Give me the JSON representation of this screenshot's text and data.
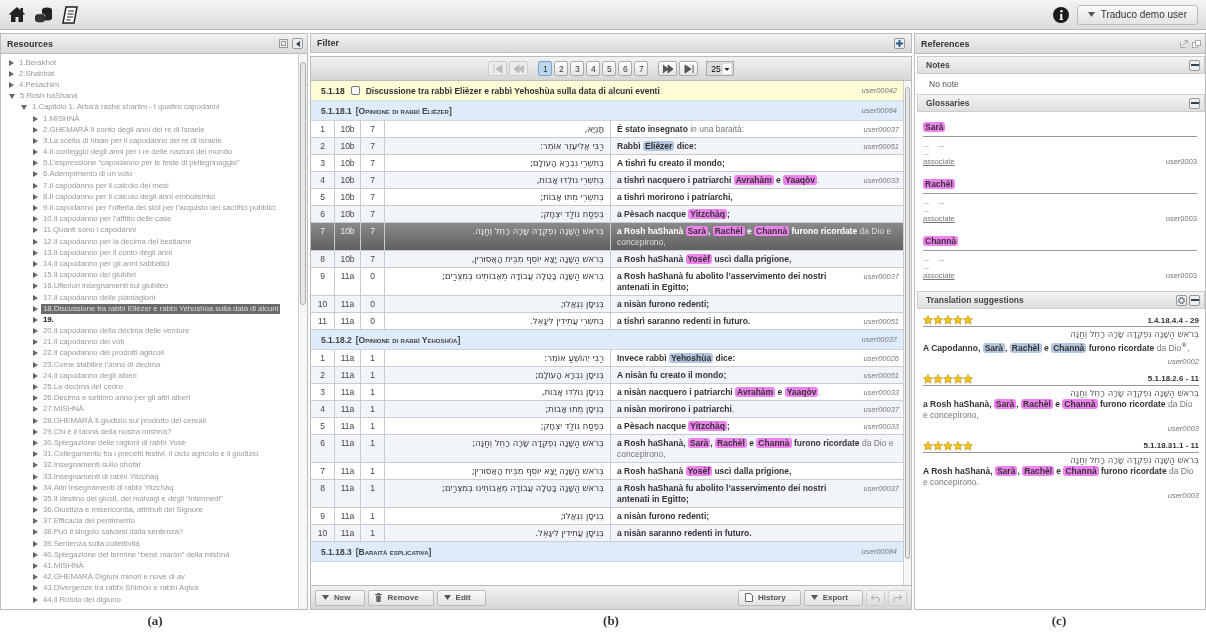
{
  "topbar": {
    "user_menu": "Traduco demo user"
  },
  "resources": {
    "title": "Resources",
    "tree": [
      {
        "label": "1.Berakhòt",
        "expanded": false,
        "selected": false,
        "bold": false
      },
      {
        "label": "2.Shabbàt",
        "expanded": false,
        "selected": false,
        "bold": false
      },
      {
        "label": "4.Pesachim",
        "expanded": false,
        "selected": false,
        "bold": false
      },
      {
        "label": "5.Rosh haShanà",
        "expanded": true,
        "selected": false,
        "bold": false,
        "children": [
          {
            "label": "1.Capitolo 1. Arba’à rashè shanim - I quattro capodanni",
            "expanded": true,
            "selected": false,
            "bold": false,
            "children": [
              {
                "label": "1.MISHNÀ",
                "expanded": false,
                "selected": false,
                "bold": false
              },
              {
                "label": "2.GHEMARÀ Il conto degli anni dei re di Israele",
                "expanded": false,
                "selected": false,
                "bold": false
              },
              {
                "label": "3.La scelta di nisàn per il capodanno dei re di Israele",
                "expanded": false,
                "selected": false,
                "bold": false
              },
              {
                "label": "4.Il conteggio degli anni per i re delle nazioni del mondo",
                "expanded": false,
                "selected": false,
                "bold": false
              },
              {
                "label": "5.L’espressione “capodanno per le feste di pellegrinaggio”",
                "expanded": false,
                "selected": false,
                "bold": false
              },
              {
                "label": "6.Adempimento di un voto",
                "expanded": false,
                "selected": false,
                "bold": false
              },
              {
                "label": "7.Il capodanno per il calcolo dei mesi",
                "expanded": false,
                "selected": false,
                "bold": false
              },
              {
                "label": "8.Il capodanno per il calcolo degli anni embolismici",
                "expanded": false,
                "selected": false,
                "bold": false
              },
              {
                "label": "9.Il capodanno per l’offerta dei sicli per l’acquisto dei sacrifici pubblici",
                "expanded": false,
                "selected": false,
                "bold": false
              },
              {
                "label": "10.Il capodanno per l’affitto delle case",
                "expanded": false,
                "selected": false,
                "bold": false
              },
              {
                "label": "11.Quanti sono i capodanni",
                "expanded": false,
                "selected": false,
                "bold": false
              },
              {
                "label": "12.Il capodanno per la decima del bestiame",
                "expanded": false,
                "selected": false,
                "bold": false
              },
              {
                "label": "13.Il capodanno per il conto degli anni",
                "expanded": false,
                "selected": false,
                "bold": false
              },
              {
                "label": "14.Il capodanno per gli anni sabbatici",
                "expanded": false,
                "selected": false,
                "bold": false
              },
              {
                "label": "15.Il capodanno dei giubilei",
                "expanded": false,
                "selected": false,
                "bold": false
              },
              {
                "label": "16.Ulteriori insegnamenti sul giubileo",
                "expanded": false,
                "selected": false,
                "bold": false
              },
              {
                "label": "17.Il capodanno delle piantagioni",
                "expanded": false,
                "selected": false,
                "bold": false
              },
              {
                "label": "18.Discussione tra rabbì Elièzer e rabbì Yehoshùa sulla data di alcuni",
                "expanded": false,
                "selected": true,
                "bold": false
              },
              {
                "label": "19.",
                "expanded": false,
                "selected": false,
                "bold": true
              },
              {
                "label": "20.Il capodanno della decima delle verdure",
                "expanded": false,
                "selected": false,
                "bold": false
              },
              {
                "label": "21.Il capodanno dei voti",
                "expanded": false,
                "selected": false,
                "bold": false
              },
              {
                "label": "22.Il capodanno dei prodotti agricoli",
                "expanded": false,
                "selected": false,
                "bold": false
              },
              {
                "label": "23.Come stabilire l’anno di decima",
                "expanded": false,
                "selected": false,
                "bold": false
              },
              {
                "label": "24.Il capodanno degli alberi",
                "expanded": false,
                "selected": false,
                "bold": false
              },
              {
                "label": "25.La decima del cedro",
                "expanded": false,
                "selected": false,
                "bold": false
              },
              {
                "label": "26.Decima e settimo anno per gli altri alberi",
                "expanded": false,
                "selected": false,
                "bold": false
              },
              {
                "label": "27.MISHNÀ",
                "expanded": false,
                "selected": false,
                "bold": false
              },
              {
                "label": "28.GHEMARÀ Il giudizio sul prodotto dei cereali",
                "expanded": false,
                "selected": false,
                "bold": false
              },
              {
                "label": "29.Chi è il tannà della nostra mishnà?",
                "expanded": false,
                "selected": false,
                "bold": false
              },
              {
                "label": "30.Spiegazione delle ragioni di rabbì Yosè",
                "expanded": false,
                "selected": false,
                "bold": false
              },
              {
                "label": "31.Collegamento fra i precetti festivi, il ciclo agricolo e il giudizio",
                "expanded": false,
                "selected": false,
                "bold": false
              },
              {
                "label": "32.Insegnamenti sullo shofàr",
                "expanded": false,
                "selected": false,
                "bold": false
              },
              {
                "label": "33.Insegnamenti di rabbì Yitzchàq",
                "expanded": false,
                "selected": false,
                "bold": false
              },
              {
                "label": "34.Altri insegnamenti di rabbì Yitzchàq",
                "expanded": false,
                "selected": false,
                "bold": false
              },
              {
                "label": "35.Il destino dei giusti, dei malvagi e degli “intermedi”",
                "expanded": false,
                "selected": false,
                "bold": false
              },
              {
                "label": "36.Giustizia e misericordia, attributi del Signore",
                "expanded": false,
                "selected": false,
                "bold": false
              },
              {
                "label": "37.Efficacia del pentimento",
                "expanded": false,
                "selected": false,
                "bold": false
              },
              {
                "label": "38.Può il singolo salvarsi dalla sentenza?",
                "expanded": false,
                "selected": false,
                "bold": false
              },
              {
                "label": "39.Sentenza sulla collettività",
                "expanded": false,
                "selected": false,
                "bold": false
              },
              {
                "label": "40.Spiegazione del termine “benè maròn” della mishnà",
                "expanded": false,
                "selected": false,
                "bold": false
              },
              {
                "label": "41.MISHNÀ",
                "expanded": false,
                "selected": false,
                "bold": false
              },
              {
                "label": "42.GHEMARÀ Digiuni minori e nove di av",
                "expanded": false,
                "selected": false,
                "bold": false
              },
              {
                "label": "43.Divergenze tra rabbì Shimòn e rabbì Aqivà",
                "expanded": false,
                "selected": false,
                "bold": false
              },
              {
                "label": "44.Il Rotolo del digiuno",
                "expanded": false,
                "selected": false,
                "bold": false
              }
            ]
          }
        ]
      }
    ]
  },
  "editor": {
    "filter_title": "Filter",
    "pager": {
      "nav_before": [
        {
          "kind": "first",
          "disabled": true
        },
        {
          "kind": "previous",
          "disabled": true
        }
      ],
      "pages": [
        {
          "label": "1",
          "selected": true
        },
        {
          "label": "2",
          "selected": false
        },
        {
          "label": "3",
          "selected": false
        },
        {
          "label": "4",
          "selected": false
        },
        {
          "label": "5",
          "selected": false
        },
        {
          "label": "6",
          "selected": false
        },
        {
          "label": "7",
          "selected": false
        }
      ],
      "nav_after": [
        {
          "kind": "next",
          "disabled": false
        },
        {
          "kind": "last",
          "disabled": false
        }
      ],
      "page_size": "25"
    },
    "segment": {
      "number": "5.1.18",
      "checked": false,
      "title": "Discussione tra rabbì Elièzer e rabbì Yehoshùa sulla data di alcuni eventi",
      "user": "user00042"
    },
    "sections": [
      {
        "number": "5.1.18.1",
        "title": "[Opinione di rabbì Elièzer]",
        "user": "user00084",
        "rows": [
          {
            "n": "1",
            "folio": "10b",
            "line": "7",
            "hebrew": "תָּנְיָא,",
            "selected": false,
            "user": "user00037",
            "segments": [
              {
                "kind": "bold",
                "text": "È stato insegnato"
              },
              {
                "kind": "plain",
                "text": " in una baraità:"
              }
            ]
          },
          {
            "n": "2",
            "folio": "10b",
            "line": "7",
            "hebrew": "רַבִּי אֱלִיעֶזֶר אוֹמֵר:",
            "selected": false,
            "user": "user00051",
            "segments": [
              {
                "kind": "bold",
                "text": "Rabbì "
              },
              {
                "kind": "tag",
                "text": "Elièzer",
                "color": "#b4c6de"
              },
              {
                "kind": "bold",
                "text": " dice:"
              }
            ]
          },
          {
            "n": "3",
            "folio": "10b",
            "line": "7",
            "hebrew": "בְּתִשְׁרֵי נִבְרָא הָעוֹלָם;",
            "selected": false,
            "segments": [
              {
                "kind": "bold",
                "text": "A tishrì fu creato il mondo;"
              }
            ]
          },
          {
            "n": "4",
            "folio": "10b",
            "line": "7",
            "hebrew": "בְּתִשְׁרֵי נוֹלְדוּ אָבוֹת,",
            "selected": false,
            "user": "user00033",
            "segments": [
              {
                "kind": "bold",
                "text": "a tishrì nacquero i patriarchi "
              },
              {
                "kind": "tag",
                "text": "Avrahàm",
                "color": "#ee82ee"
              },
              {
                "kind": "bold",
                "text": " e "
              },
              {
                "kind": "tag",
                "text": "Yaaqòv",
                "color": "#ee82ee"
              },
              {
                "kind": "plain",
                "text": "."
              }
            ]
          },
          {
            "n": "5",
            "folio": "10b",
            "line": "7",
            "hebrew": "בְּתִשְׁרֵי מֵתוּ אָבוֹת;",
            "selected": false,
            "segments": [
              {
                "kind": "bold",
                "text": "a tishrì morirono i patriarchi,"
              }
            ]
          },
          {
            "n": "6",
            "folio": "10b",
            "line": "7",
            "hebrew": "בְּפֶסַח נוֹלַד יִצְחָק;",
            "selected": false,
            "segments": [
              {
                "kind": "bold",
                "text": "a Pèsach nacque "
              },
              {
                "kind": "tag",
                "text": "Yitzchàq",
                "color": "#ee82ee"
              },
              {
                "kind": "bold",
                "text": ";"
              }
            ]
          },
          {
            "n": "7",
            "folio": "10b",
            "line": "7",
            "hebrew": "בְּרֹאשׁ הַשָּׁנָה נִפְקְדָה שָׂרָה רָחֵל וְחַנָּה.",
            "selected": true,
            "segments": [
              {
                "kind": "bold",
                "text": "a Rosh haShanà "
              },
              {
                "kind": "tag",
                "text": "Sarà",
                "color": "#ee82ee"
              },
              {
                "kind": "bold",
                "text": ", "
              },
              {
                "kind": "tag",
                "text": "Rachèl",
                "color": "#ee82ee"
              },
              {
                "kind": "bold",
                "text": " e "
              },
              {
                "kind": "tag",
                "text": "Channà",
                "color": "#ee82ee"
              },
              {
                "kind": "bold",
                "text": " furono ricordate"
              },
              {
                "kind": "plain",
                "text": " da Dio e concepirono,"
              }
            ]
          },
          {
            "n": "8",
            "folio": "10b",
            "line": "7",
            "hebrew": "בְּרֹאשׁ הַשָּׁנָה יָצָא יוֹסֵף מִבֵּית הָאֲסוּרִין,",
            "selected": false,
            "segments": [
              {
                "kind": "bold",
                "text": "a Rosh haShanà "
              },
              {
                "kind": "tag",
                "text": "Yosèf",
                "color": "#ee82ee"
              },
              {
                "kind": "bold",
                "text": " uscì dalla prigione,"
              }
            ]
          },
          {
            "n": "9",
            "folio": "11a",
            "line": "0",
            "hebrew": "בְּרֹאשׁ הַשָּׁנָה בָּטְלָה עֲבוֹדָה מֵאֲבוֹתֵינוּ בְּמִצְרַיִם;",
            "selected": false,
            "user": "user00037",
            "segments": [
              {
                "kind": "bold",
                "text": "a Rosh haShanà fu abolito l’asservimento dei nostri antenati in Egitto;"
              }
            ]
          },
          {
            "n": "10",
            "folio": "11a",
            "line": "0",
            "hebrew": "בְּנִיסָן נִגְאֲלוּ;",
            "selected": false,
            "segments": [
              {
                "kind": "bold",
                "text": "a nisàn furono redenti;"
              }
            ]
          },
          {
            "n": "11",
            "folio": "11a",
            "line": "0",
            "hebrew": "בְּתִשְׁרֵי עֲתִידִין לִיגָּאֵל.",
            "selected": false,
            "user": "user00051",
            "segments": [
              {
                "kind": "bold",
                "text": "a tishrì saranno redenti in futuro."
              }
            ]
          }
        ]
      },
      {
        "number": "5.1.18.2",
        "title": "[Opinione di rabbì Yehoshùa]",
        "user": "user00037",
        "rows": [
          {
            "n": "1",
            "folio": "11a",
            "line": "1",
            "hebrew": "רַבִּי יְהוֹשֻׁעַ אוֹמֵר:",
            "selected": false,
            "user": "user00026",
            "segments": [
              {
                "kind": "bold",
                "text": "Invece rabbì "
              },
              {
                "kind": "tag",
                "text": "Yehoshùa",
                "color": "#b4c6de"
              },
              {
                "kind": "bold",
                "text": " dice:"
              }
            ]
          },
          {
            "n": "2",
            "folio": "11a",
            "line": "1",
            "hebrew": "בְּנִיסָן נִבְרָא הָעוֹלָם;",
            "selected": false,
            "user": "user00051",
            "segments": [
              {
                "kind": "bold",
                "text": "A nisàn fu creato il mondo;"
              }
            ]
          },
          {
            "n": "3",
            "folio": "11a",
            "line": "1",
            "hebrew": "בְּנִיסָן נוֹלְדוּ אָבוֹת,",
            "selected": false,
            "user": "user00033",
            "segments": [
              {
                "kind": "bold",
                "text": "a nisàn nacquero i patriarchi "
              },
              {
                "kind": "tag",
                "text": "Avrahàm",
                "color": "#ee82ee"
              },
              {
                "kind": "bold",
                "text": " e "
              },
              {
                "kind": "tag",
                "text": "Yaaqòv",
                "color": "#ee82ee"
              },
              {
                "kind": "plain",
                "text": "."
              }
            ]
          },
          {
            "n": "4",
            "folio": "11a",
            "line": "1",
            "hebrew": "בְּנִיסָן מֵתוּ אָבוֹת;",
            "selected": false,
            "user": "user00037",
            "segments": [
              {
                "kind": "bold",
                "text": "a nisàn morirono i patriarchi"
              },
              {
                "kind": "plain",
                "text": ","
              }
            ]
          },
          {
            "n": "5",
            "folio": "11a",
            "line": "1",
            "hebrew": "בְּפֶסַח נוֹלַד יִצְחָק;",
            "selected": false,
            "user": "user00033",
            "segments": [
              {
                "kind": "bold",
                "text": "a Pèsach nacque "
              },
              {
                "kind": "tag",
                "text": "Yitzchàq",
                "color": "#ee82ee"
              },
              {
                "kind": "bold",
                "text": ";"
              }
            ]
          },
          {
            "n": "6",
            "folio": "11a",
            "line": "1",
            "hebrew": "בְּרֹאשׁ הַשָּׁנָה נִפְקְדָה שָׂרָה רָחֵל וְחַנָּה;",
            "selected": false,
            "segments": [
              {
                "kind": "bold",
                "text": "a Rosh haShanà, "
              },
              {
                "kind": "tag",
                "text": "Sarà",
                "color": "#ee82ee"
              },
              {
                "kind": "bold",
                "text": ", "
              },
              {
                "kind": "tag",
                "text": "Rachèl",
                "color": "#ee82ee"
              },
              {
                "kind": "bold",
                "text": " e "
              },
              {
                "kind": "tag",
                "text": "Channà",
                "color": "#ee82ee"
              },
              {
                "kind": "bold",
                "text": " furono ricordate"
              },
              {
                "kind": "plain",
                "text": " da Dio e concepirono,"
              }
            ]
          },
          {
            "n": "7",
            "folio": "11a",
            "line": "1",
            "hebrew": "בְּרֹאשׁ הַשָּׁנָה יָצָא יוֹסֵף מִבֵּית הָאֲסוּרִין;",
            "selected": false,
            "segments": [
              {
                "kind": "bold",
                "text": "a Rosh haShanà "
              },
              {
                "kind": "tag",
                "text": "Yosèf",
                "color": "#ee82ee"
              },
              {
                "kind": "bold",
                "text": " uscì dalla prigione,"
              }
            ]
          },
          {
            "n": "8",
            "folio": "11a",
            "line": "1",
            "hebrew": "בְּרֹאשׁ הַשָּׁנָה בָּטְלָה עֲבוֹדָה מֵאֲבוֹתֵינוּ בְּמִצְרַיִם;",
            "selected": false,
            "user": "user00037",
            "segments": [
              {
                "kind": "bold",
                "text": "a Rosh haShanà fu abolito l’asservimento dei nostri antenati in Egitto;"
              }
            ]
          },
          {
            "n": "9",
            "folio": "11a",
            "line": "1",
            "hebrew": "בְּנִיסָן נִגְאֲלוּ;",
            "selected": false,
            "segments": [
              {
                "kind": "bold",
                "text": "a nisàn furono redenti;"
              }
            ]
          },
          {
            "n": "10",
            "folio": "11a",
            "line": "1",
            "hebrew": "בְּנִיסָן עֲתִידִין לִיגָּאֵל.",
            "selected": false,
            "segments": [
              {
                "kind": "bold",
                "text": "a nisàn saranno redenti in futuro."
              }
            ]
          }
        ]
      },
      {
        "number": "5.1.18.3",
        "title": "[Baraità esplicativa]",
        "user": "user00084"
      }
    ],
    "actions_left": [
      {
        "label": "New",
        "kind": "menu"
      },
      {
        "label": "Remove",
        "kind": "trash"
      },
      {
        "label": "Edit",
        "kind": "menu"
      }
    ],
    "actions_right": [
      {
        "label": "History",
        "kind": "history"
      },
      {
        "label": "Export",
        "kind": "menu"
      }
    ],
    "history_nav": [
      {
        "kind": "undo",
        "disabled": true
      },
      {
        "kind": "redo",
        "disabled": true
      }
    ]
  },
  "references": {
    "title": "References",
    "notes": {
      "title": "Notes",
      "empty_text": "No note"
    },
    "glossaries": {
      "title": "Glossaries",
      "entries": [
        {
          "term": "Sarà",
          "color": "#ee82ee",
          "fields": [
            "...",
            "..."
          ],
          "note": "...",
          "link": "associate",
          "user": "user0003"
        },
        {
          "term": "Rachèl",
          "color": "#ee82ee",
          "fields": [
            "...",
            "..."
          ],
          "note": "...",
          "link": "associate",
          "user": "user0003"
        },
        {
          "term": "Channà",
          "color": "#ee82ee",
          "fields": [
            "...",
            "..."
          ],
          "note": "...",
          "link": "associate",
          "user": "user0003"
        }
      ]
    },
    "suggestions": {
      "title": "Translation suggestions",
      "items": [
        {
          "stars": 5,
          "ref": "1.4.18.4.4 - 29",
          "hebrew": "בְּרֹאשׁ הַשָּׁנָה נִפְקְדָה שָׂרָה רָחֵל וְחַנָּה",
          "user": "user0002",
          "segments": [
            {
              "kind": "bold",
              "text": "A Capodanno, "
            },
            {
              "kind": "tag",
              "text": "Sarà",
              "color": "#b4c6de"
            },
            {
              "kind": "bold",
              "text": ", "
            },
            {
              "kind": "tag",
              "text": "Rachèl",
              "color": "#b4c6de"
            },
            {
              "kind": "bold",
              "text": " e "
            },
            {
              "kind": "tag",
              "text": "Channà",
              "color": "#b4c6de"
            },
            {
              "kind": "bold",
              "text": " furono ricordate"
            },
            {
              "kind": "plain",
              "text": " da Dio"
            },
            {
              "kind": "sup",
              "text": "⑧"
            },
            {
              "kind": "plain",
              "text": ","
            }
          ]
        },
        {
          "stars": 5,
          "ref": "5.1.18.2.6 - 11",
          "hebrew": "בְּרֹאשׁ הַשָּׁנָה נִפְקְדָה שָׂרָה רָחֵל וְחַנָּה",
          "user": "user0003",
          "segments": [
            {
              "kind": "bold",
              "text": "a Rosh haShanà, "
            },
            {
              "kind": "tag",
              "text": "Sarà",
              "color": "#ee82ee"
            },
            {
              "kind": "bold",
              "text": ", "
            },
            {
              "kind": "tag",
              "text": "Rachèl",
              "color": "#ee82ee"
            },
            {
              "kind": "bold",
              "text": " e "
            },
            {
              "kind": "tag",
              "text": "Channà",
              "color": "#ee82ee"
            },
            {
              "kind": "bold",
              "text": " furono ricordate"
            },
            {
              "kind": "plain",
              "text": " da Dio e concepirono,"
            }
          ]
        },
        {
          "stars": 5,
          "ref": "5.1.18.31.1 - 11",
          "hebrew": "בְּרֹאשׁ הַשָּׁנָה נִפְקְדָה שָׂרָה רָחֵל וְחַנָּה",
          "user": "user0003",
          "segments": [
            {
              "kind": "bold",
              "text": "A Rosh haShanà, "
            },
            {
              "kind": "tag",
              "text": "Sarà",
              "color": "#ee82ee"
            },
            {
              "kind": "bold",
              "text": ", "
            },
            {
              "kind": "tag",
              "text": "Rachèl",
              "color": "#ee82ee"
            },
            {
              "kind": "bold",
              "text": " e "
            },
            {
              "kind": "tag",
              "text": "Channà",
              "color": "#ee82ee"
            },
            {
              "kind": "bold",
              "text": " furono ricordate"
            },
            {
              "kind": "plain",
              "text": " da Dio e concepirono."
            }
          ]
        }
      ]
    }
  },
  "captions": [
    "(a)",
    "(b)",
    "(c)"
  ]
}
